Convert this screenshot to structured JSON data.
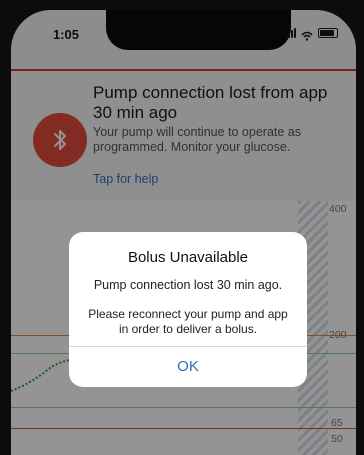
{
  "status_bar": {
    "time": "1:05"
  },
  "notification": {
    "title": "Pump connection lost from app 30 min ago",
    "body": "Your pump will continue to operate as programmed. Monitor your glucose.",
    "link": "Tap for help",
    "icon": "bluetooth-icon"
  },
  "chart": {
    "axis_labels": [
      "400",
      "200",
      "65",
      "50"
    ],
    "colors": {
      "high_line": "#e28a36",
      "target_band": "#8ed39a",
      "low_line": "#e04b3b"
    }
  },
  "dialog": {
    "title": "Bolus Unavailable",
    "message1": "Pump connection lost 30 min ago.",
    "message2": "Please reconnect your pump and app in order to deliver a bolus.",
    "button": "OK"
  },
  "colors": {
    "accent": "#2f6fbd",
    "alert_red": "#d9382e"
  }
}
